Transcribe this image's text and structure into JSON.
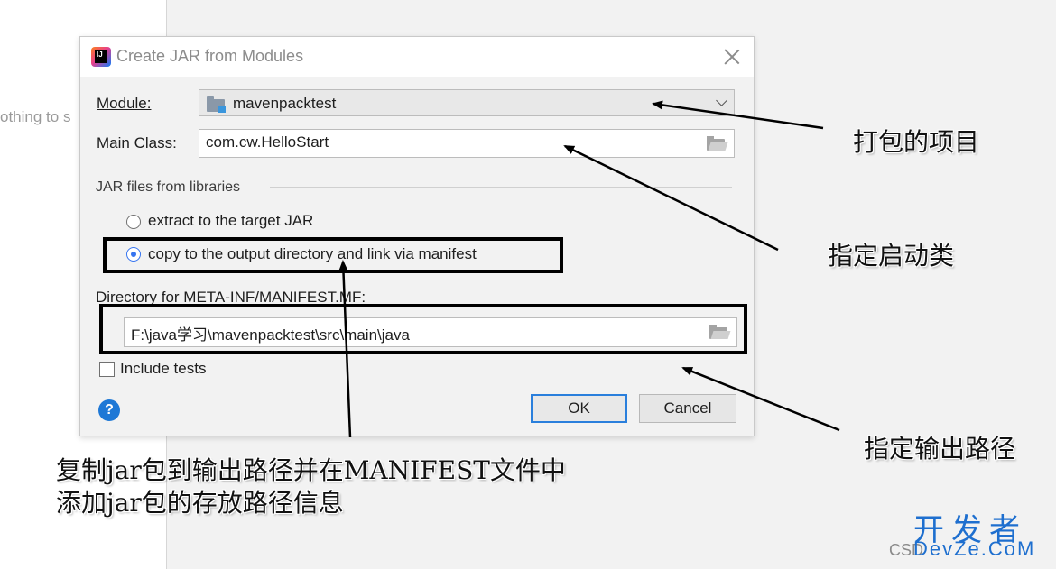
{
  "background": {
    "hint_text": "othing to s"
  },
  "dialog": {
    "title": "Create JAR from Modules",
    "module_label": "Module:",
    "module_value": "mavenpacktest",
    "main_class_label": "Main Class:",
    "main_class_value": "com.cw.HelloStart",
    "libraries_section": "JAR files from libraries",
    "radio_extract": "extract to the target JAR",
    "radio_copy": "copy to the output directory and link via manifest",
    "selected_option": "copy",
    "manifest_dir_label": "Directory for META-INF/MANIFEST.MF:",
    "manifest_dir_value": "F:\\java学习\\mavenpacktest\\src\\main\\java",
    "include_tests_label": "Include tests",
    "include_tests_checked": false,
    "help_glyph": "?",
    "ok_label": "OK",
    "cancel_label": "Cancel"
  },
  "annotations": {
    "module_note": "打包的项目",
    "main_class_note": "指定启动类",
    "output_note": "指定输出路径",
    "copy_note_line1": "复制jar包到输出路径并在MANIFEST文件中",
    "copy_note_line2": "添加jar包的存放路径信息"
  },
  "watermark": {
    "logo": "开发者",
    "site": "DevZe.CoM",
    "prefix": "CSD"
  },
  "colors": {
    "accent": "#3574f0",
    "help": "#1e78d6",
    "highlight_border": "#000000"
  },
  "icons": [
    "app-logo-icon",
    "close-icon",
    "module-icon",
    "chevron-down-icon",
    "folder-icon",
    "help-icon"
  ]
}
